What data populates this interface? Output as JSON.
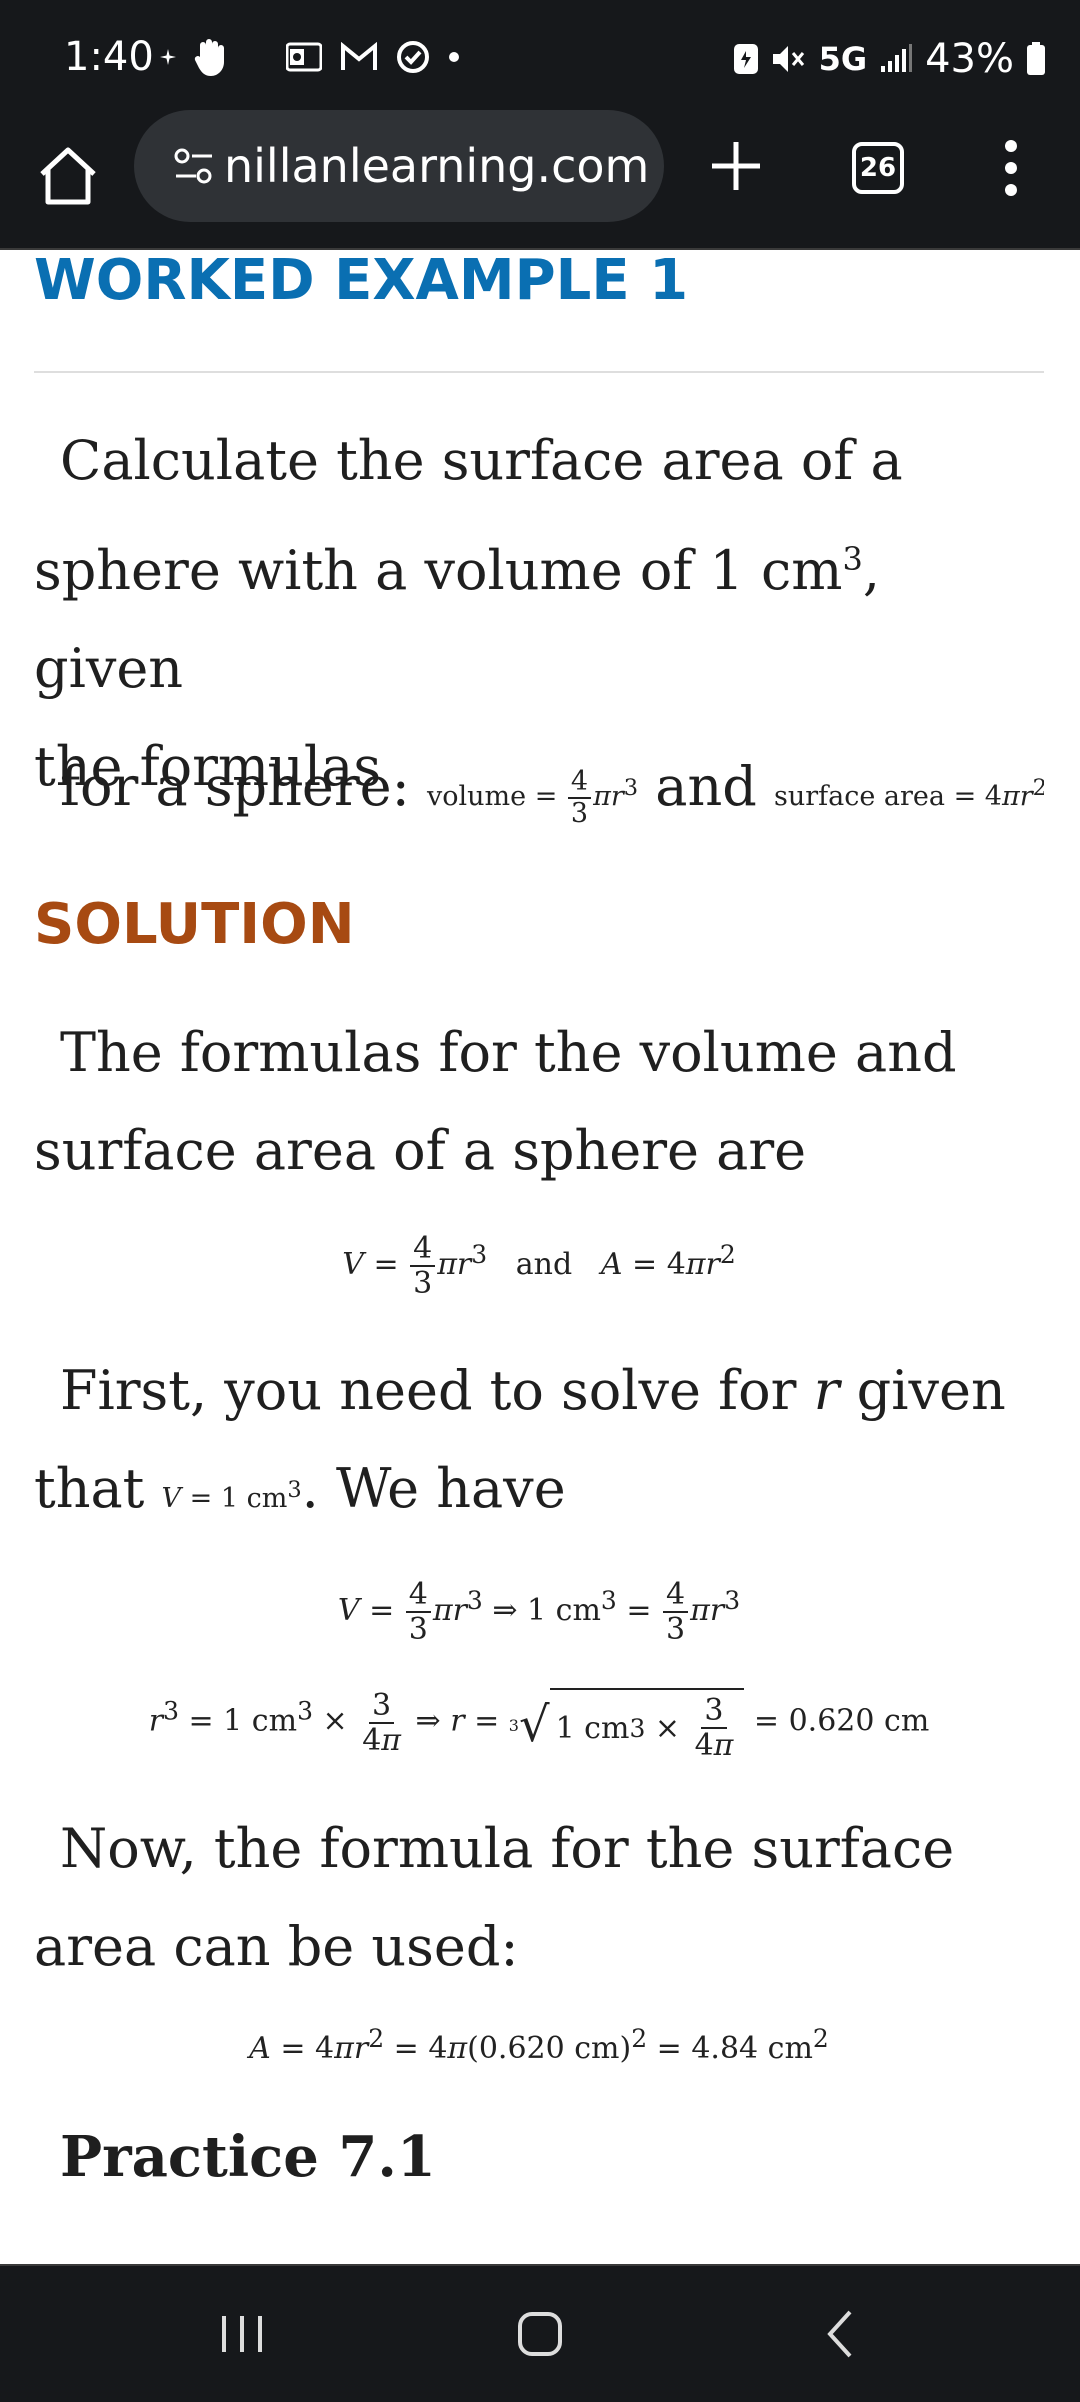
{
  "status_bar": {
    "time": "1:40",
    "network": "5G",
    "battery": "43%"
  },
  "toolbar": {
    "url": "nillanlearning.com",
    "tab_count": "26"
  },
  "article": {
    "worked_heading": "WORKED EXAMPLE 1",
    "question_line1": "Calculate the surface area of a",
    "question_line2_pre": "sphere with a volume of 1 cm",
    "question_line2_post": ", given",
    "question_line3": "the formulas",
    "for_a_sphere": "for a sphere:",
    "volume_label": "volume",
    "and_word": "and",
    "surface_area_label": "surface area",
    "solution_heading": "SOLUTION",
    "solution_p1_line1": "The formulas for the volume and",
    "solution_p1_line2": "surface area of a sphere are",
    "eq1_and": "and",
    "solution_p2_line1_pre": "First, you need to solve for ",
    "solution_p2_var": "r",
    "solution_p2_line1_post": " given",
    "solution_p2_line2_pre": "that ",
    "solution_p2_line2_post": ". We have",
    "result_r": "0.620 cm",
    "solution_p3_line1": "Now, the formula for the surface",
    "solution_p3_line2": "area can be used:",
    "result_area": "4.84 cm",
    "practice_heading": "Practice 7.1"
  }
}
